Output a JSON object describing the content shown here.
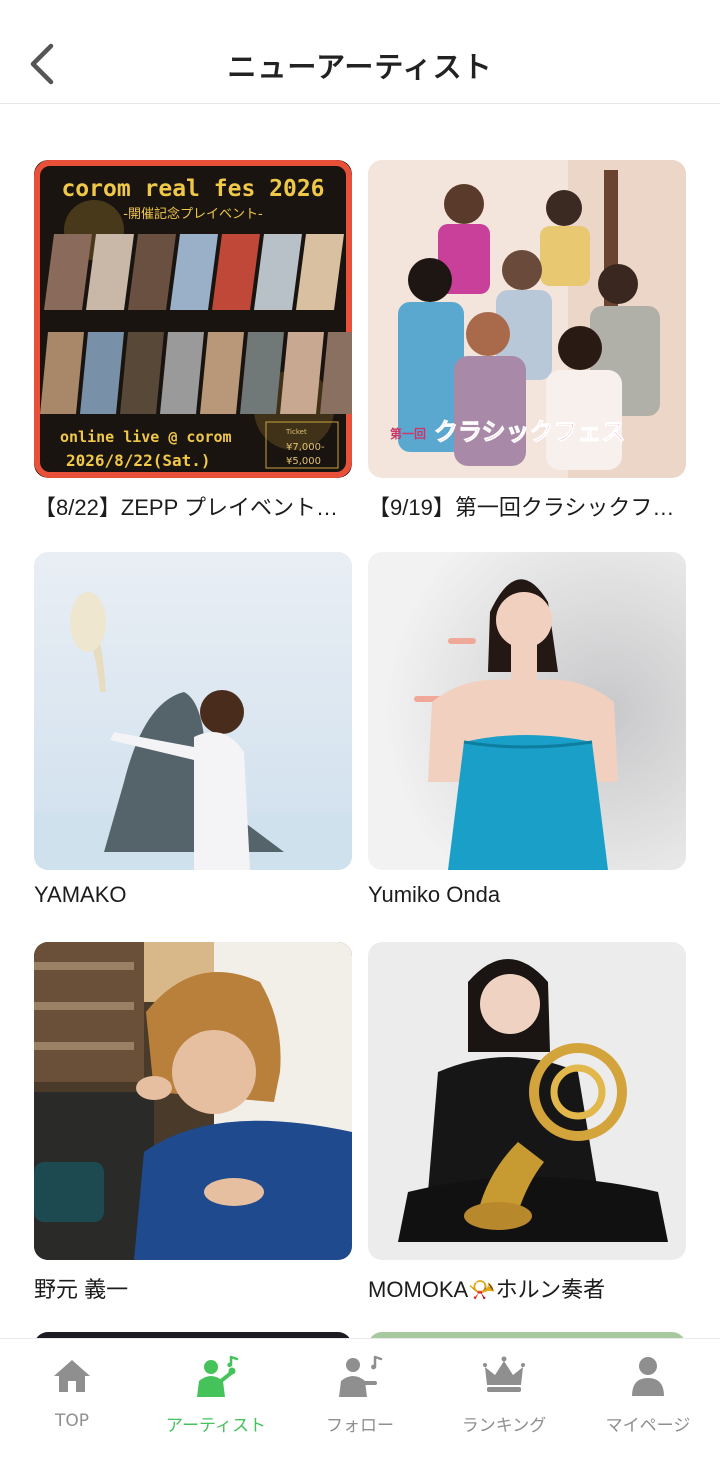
{
  "header": {
    "title": "ニューアーティスト"
  },
  "cards": [
    {
      "title": "【8/22】ZEPP プレイベント…",
      "poster": {
        "headline": "corom real fes 2026",
        "subheadline": "-開催記念プレイベント-",
        "footer_line1": "online live @ corom",
        "footer_line2": "2026/8/22(Sat.)",
        "ticket_label": "Ticket",
        "ticket_price1": "¥7,000-",
        "ticket_price2": "¥5,000"
      }
    },
    {
      "title": "【9/19】第一回クラシックフ…",
      "poster": {
        "banner": "クラシックフェス",
        "banner_prefix": "第一回"
      }
    },
    {
      "title": "YAMAKO"
    },
    {
      "title": "Yumiko Onda"
    },
    {
      "title": "野元 義一"
    },
    {
      "title": "MOMOKA📯ホルン奏者"
    }
  ],
  "nav": {
    "items": [
      {
        "label": "TOP",
        "icon": "home-icon"
      },
      {
        "label": "アーティスト",
        "icon": "artist-icon",
        "active": true
      },
      {
        "label": "フォロー",
        "icon": "follow-icon"
      },
      {
        "label": "ランキング",
        "icon": "crown-icon"
      },
      {
        "label": "マイページ",
        "icon": "person-icon"
      }
    ]
  },
  "colors": {
    "accent": "#45c35a",
    "inactive": "#8f8f8f",
    "highlight_border": "#e8503a"
  }
}
